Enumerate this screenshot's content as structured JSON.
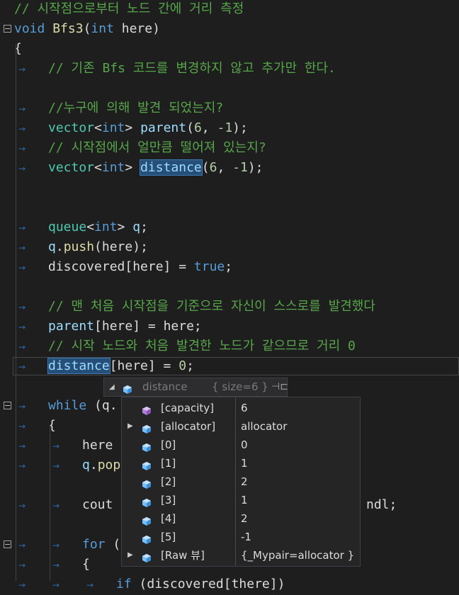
{
  "editor": {
    "lines": [
      {
        "segments": [
          {
            "t": "// 시작점으로부터 노드 간에 거리 측정",
            "c": "cm"
          }
        ]
      },
      {
        "fold": "minus",
        "segments": [
          {
            "t": "void",
            "c": "kw"
          },
          {
            "t": " ",
            "c": "op"
          },
          {
            "t": "Bfs3",
            "c": "fn"
          },
          {
            "t": "(",
            "c": "op"
          },
          {
            "t": "int",
            "c": "kw"
          },
          {
            "t": " here)",
            "c": "op"
          }
        ]
      },
      {
        "segments": [
          {
            "t": "{",
            "c": "op"
          }
        ]
      },
      {
        "indent": 1,
        "segments": [
          {
            "t": "// 기존 Bfs 코드를 변경하지 않고 추가만 한다.",
            "c": "cm"
          }
        ]
      },
      {
        "segments": []
      },
      {
        "indent": 1,
        "segments": [
          {
            "t": "//누구에 의해 발견 되었는지?",
            "c": "cm"
          }
        ]
      },
      {
        "indent": 1,
        "segments": [
          {
            "t": "vector",
            "c": "ty"
          },
          {
            "t": "<",
            "c": "op"
          },
          {
            "t": "int",
            "c": "kw"
          },
          {
            "t": "> ",
            "c": "op"
          },
          {
            "t": "parent",
            "c": "var"
          },
          {
            "t": "(",
            "c": "op"
          },
          {
            "t": "6",
            "c": "num"
          },
          {
            "t": ", ",
            "c": "op"
          },
          {
            "t": "-1",
            "c": "num"
          },
          {
            "t": ");",
            "c": "op"
          }
        ]
      },
      {
        "indent": 1,
        "segments": [
          {
            "t": "// 시작점에서 얼만큼 떨어져 있는지?",
            "c": "cm"
          }
        ]
      },
      {
        "indent": 1,
        "segments": [
          {
            "t": "vector",
            "c": "ty"
          },
          {
            "t": "<",
            "c": "op"
          },
          {
            "t": "int",
            "c": "kw"
          },
          {
            "t": "> ",
            "c": "op"
          },
          {
            "t": "distance",
            "c": "var",
            "hl": true
          },
          {
            "t": "(",
            "c": "op"
          },
          {
            "t": "6",
            "c": "num"
          },
          {
            "t": ", ",
            "c": "op"
          },
          {
            "t": "-1",
            "c": "num"
          },
          {
            "t": ");",
            "c": "op"
          }
        ]
      },
      {
        "segments": []
      },
      {
        "segments": []
      },
      {
        "indent": 1,
        "segments": [
          {
            "t": "queue",
            "c": "ty"
          },
          {
            "t": "<",
            "c": "op"
          },
          {
            "t": "int",
            "c": "kw"
          },
          {
            "t": "> ",
            "c": "op"
          },
          {
            "t": "q",
            "c": "var"
          },
          {
            "t": ";",
            "c": "op"
          }
        ]
      },
      {
        "indent": 1,
        "segments": [
          {
            "t": "q",
            "c": "var"
          },
          {
            "t": ".",
            "c": "op"
          },
          {
            "t": "push",
            "c": "fn"
          },
          {
            "t": "(here);",
            "c": "op"
          }
        ]
      },
      {
        "indent": 1,
        "segments": [
          {
            "t": "discovered[here] = ",
            "c": "op"
          },
          {
            "t": "true",
            "c": "kw"
          },
          {
            "t": ";",
            "c": "op"
          }
        ]
      },
      {
        "segments": []
      },
      {
        "indent": 1,
        "segments": [
          {
            "t": "// 맨 처음 시작점을 기준으로 자신이 스스로를 발견했다",
            "c": "cm"
          }
        ]
      },
      {
        "indent": 1,
        "segments": [
          {
            "t": "parent",
            "c": "var"
          },
          {
            "t": "[here] = here;",
            "c": "op"
          }
        ]
      },
      {
        "indent": 1,
        "segments": [
          {
            "t": "// 시작 노드와 처음 발견한 노드가 같으므로 거리 0",
            "c": "cm"
          }
        ]
      },
      {
        "indent": 1,
        "current": true,
        "segments": [
          {
            "t": "distance",
            "c": "var",
            "hl": true
          },
          {
            "t": "[here] = ",
            "c": "op"
          },
          {
            "t": "0",
            "c": "num"
          },
          {
            "t": ";",
            "c": "op"
          }
        ]
      },
      {
        "segments": []
      },
      {
        "indent": 1,
        "fold": "minus",
        "segments": [
          {
            "t": "while",
            "c": "kw"
          },
          {
            "t": " (q.",
            "c": "op"
          }
        ]
      },
      {
        "indent": 1,
        "segments": [
          {
            "t": "{",
            "c": "op"
          }
        ]
      },
      {
        "indent": 2,
        "segments": [
          {
            "t": "here",
            "c": "op"
          }
        ]
      },
      {
        "indent": 2,
        "segments": [
          {
            "t": "q",
            "c": "var"
          },
          {
            "t": ".",
            "c": "op"
          },
          {
            "t": "pop",
            "c": "fn"
          }
        ]
      },
      {
        "segments": []
      },
      {
        "indent": 2,
        "segments": [
          {
            "t": "cout",
            "c": "op"
          },
          {
            "t": "                                 ",
            "c": "op"
          },
          {
            "t": "ndl;",
            "c": "op"
          }
        ]
      },
      {
        "segments": []
      },
      {
        "indent": 2,
        "fold": "minus",
        "segments": [
          {
            "t": "for",
            "c": "kw"
          },
          {
            "t": " (",
            "c": "op"
          }
        ]
      },
      {
        "indent": 2,
        "segments": [
          {
            "t": "{",
            "c": "op"
          }
        ]
      },
      {
        "indent": 3,
        "segments": [
          {
            "t": "if",
            "c": "kw"
          },
          {
            "t": " (discovered[there])",
            "c": "op"
          }
        ]
      }
    ]
  },
  "datatip": {
    "title": "distance",
    "size_text": "{ size=6 }",
    "rows": [
      {
        "name": "[capacity]",
        "value": "6",
        "icon": "purple",
        "expandable": false
      },
      {
        "name": "[allocator]",
        "value": "allocator",
        "icon": "blue",
        "expandable": true
      },
      {
        "name": "[0]",
        "value": "0",
        "icon": "blue",
        "expandable": false
      },
      {
        "name": "[1]",
        "value": "1",
        "icon": "blue",
        "expandable": false
      },
      {
        "name": "[2]",
        "value": "2",
        "icon": "blue",
        "expandable": false
      },
      {
        "name": "[3]",
        "value": "1",
        "icon": "blue",
        "expandable": false
      },
      {
        "name": "[4]",
        "value": "2",
        "icon": "blue",
        "expandable": false
      },
      {
        "name": "[5]",
        "value": "-1",
        "icon": "blue",
        "expandable": false
      },
      {
        "name": "[Raw 뷰]",
        "value": "{_Mypair=allocator }",
        "icon": "blue",
        "expandable": true
      }
    ]
  }
}
